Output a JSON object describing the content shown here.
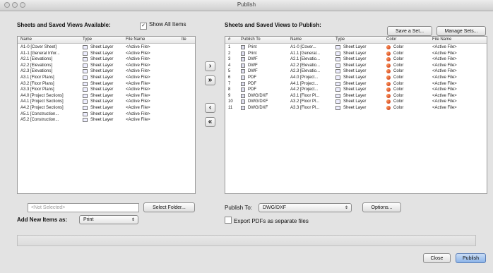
{
  "window": {
    "title": "Publish"
  },
  "left": {
    "heading": "Sheets and Saved Views Available:",
    "show_all_label": "Show All Items",
    "show_all_checked": "✓",
    "columns": [
      "Name",
      "Type",
      "File Name",
      "Ite"
    ],
    "rows": [
      {
        "name": "A1-0 [Cover Sheet]",
        "type": "Sheet Layer",
        "file": "<Active File>"
      },
      {
        "name": "A1-1 [General Infor...",
        "type": "Sheet Layer",
        "file": "<Active File>"
      },
      {
        "name": "A2.1 [Elevations]",
        "type": "Sheet Layer",
        "file": "<Active File>"
      },
      {
        "name": "A2.2 [Elevations]",
        "type": "Sheet Layer",
        "file": "<Active File>"
      },
      {
        "name": "A2.3 [Elevations]",
        "type": "Sheet Layer",
        "file": "<Active File>"
      },
      {
        "name": "A3.1 [Floor Plans]",
        "type": "Sheet Layer",
        "file": "<Active File>"
      },
      {
        "name": "A3.2 [Floor Plans]",
        "type": "Sheet Layer",
        "file": "<Active File>"
      },
      {
        "name": "A3.3 [Floor Plans]",
        "type": "Sheet Layer",
        "file": "<Active File>"
      },
      {
        "name": "A4.0 [Project Sections]",
        "type": "Sheet Layer",
        "file": "<Active File>"
      },
      {
        "name": "A4.1 [Project Sections]",
        "type": "Sheet Layer",
        "file": "<Active File>"
      },
      {
        "name": "A4.2 [Project Sections]",
        "type": "Sheet Layer",
        "file": "<Active File>"
      },
      {
        "name": "A5.1 [Construction...",
        "type": "Sheet Layer",
        "file": "<Active File>"
      },
      {
        "name": "A5.2 [Construction...",
        "type": "Sheet Layer",
        "file": "<Active File>"
      }
    ],
    "folder_placeholder": "<Not Selected>",
    "select_folder_label": "Select Folder...",
    "add_new_items_label": "Add New Items as:",
    "add_new_items_value": "Print"
  },
  "arrows": {
    "add_one": "›",
    "add_all": "»",
    "remove_one": "‹",
    "remove_all": "«"
  },
  "right": {
    "heading": "Sheets and Saved Views to Publish:",
    "save_set_label": "Save a Set...",
    "manage_sets_label": "Manage Sets...",
    "columns": [
      "#",
      "Publish To",
      "Name",
      "Type",
      "Color",
      "File Name"
    ],
    "rows": [
      {
        "num": "1",
        "publish": "Print",
        "name": "A1-0 [Cover...",
        "type": "Sheet Layer",
        "color": "Color",
        "file": "<Active File>"
      },
      {
        "num": "2",
        "publish": "Print",
        "name": "A1.1 [General...",
        "type": "Sheet Layer",
        "color": "Color",
        "file": "<Active File>"
      },
      {
        "num": "3",
        "publish": "DWF",
        "name": "A2.1 [Elevatio...",
        "type": "Sheet Layer",
        "color": "Color",
        "file": "<Active File>"
      },
      {
        "num": "4",
        "publish": "DWF",
        "name": "A2.2 [Elevatio...",
        "type": "Sheet Layer",
        "color": "Color",
        "file": "<Active File>"
      },
      {
        "num": "5",
        "publish": "DWF",
        "name": "A2.3 [Elevatio...",
        "type": "Sheet Layer",
        "color": "Color",
        "file": "<Active File>"
      },
      {
        "num": "6",
        "publish": "PDF",
        "name": "A4.0 [Project...",
        "type": "Sheet Layer",
        "color": "Color",
        "file": "<Active File>"
      },
      {
        "num": "7",
        "publish": "PDF",
        "name": "A4.1 [Project...",
        "type": "Sheet Layer",
        "color": "Color",
        "file": "<Active File>"
      },
      {
        "num": "8",
        "publish": "PDF",
        "name": "A4.2 [Project...",
        "type": "Sheet Layer",
        "color": "Color",
        "file": "<Active File>"
      },
      {
        "num": "9",
        "publish": "DWG/DXF",
        "name": "A3.1 [Floor Pl...",
        "type": "Sheet Layer",
        "color": "Color",
        "file": "<Active File>"
      },
      {
        "num": "10",
        "publish": "DWG/DXF",
        "name": "A3.2 [Floor Pl...",
        "type": "Sheet Layer",
        "color": "Color",
        "file": "<Active File>"
      },
      {
        "num": "11",
        "publish": "DWG/DXF",
        "name": "A3.3 [Floor Pl...",
        "type": "Sheet Layer",
        "color": "Color",
        "file": "<Active File>"
      }
    ],
    "publish_to_label": "Publish To:",
    "publish_to_value": "DWG/DXF",
    "options_label": "Options...",
    "export_pdfs_label": "Export PDFs as separate files"
  },
  "footer": {
    "close_label": "Close",
    "publish_label": "Publish"
  }
}
